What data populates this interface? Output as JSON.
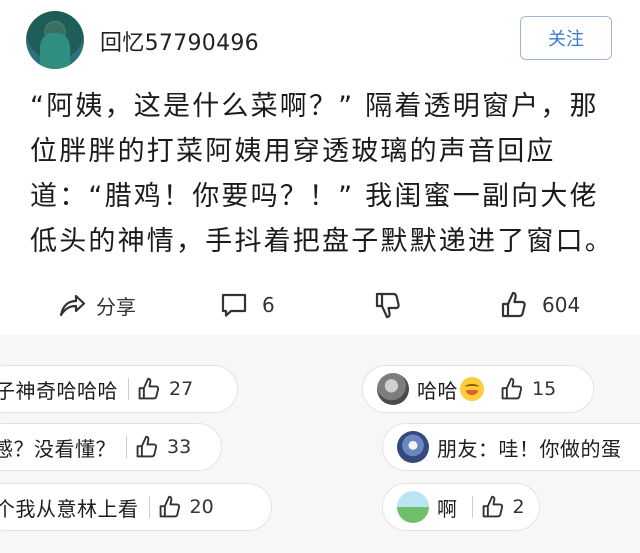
{
  "header": {
    "username": "回忆57790496",
    "follow_label": "关注"
  },
  "post": {
    "text": "“阿姨，这是什么菜啊？” 隔着透明窗户，那位胖胖的打菜阿姨用穿透玻璃的声音回应道：“腊鸡！你要吗？！” 我闺蜜一副向大佬低头的神情，手抖着把盘子默默递进了窗口。"
  },
  "actions": {
    "share_label": "分享",
    "comment_count": "6",
    "like_count": "604"
  },
  "comments": [
    {
      "text": "子神奇哈哈哈",
      "likes": "27"
    },
    {
      "text": "哈哈",
      "likes": "15",
      "emoji": "grinning-face"
    },
    {
      "text": "感？没看懂？",
      "likes": "33"
    },
    {
      "text": "朋友：哇！你做的蛋"
    },
    {
      "text": "个我从意林上看",
      "likes": "20"
    },
    {
      "text": "啊",
      "likes": "2"
    }
  ]
}
